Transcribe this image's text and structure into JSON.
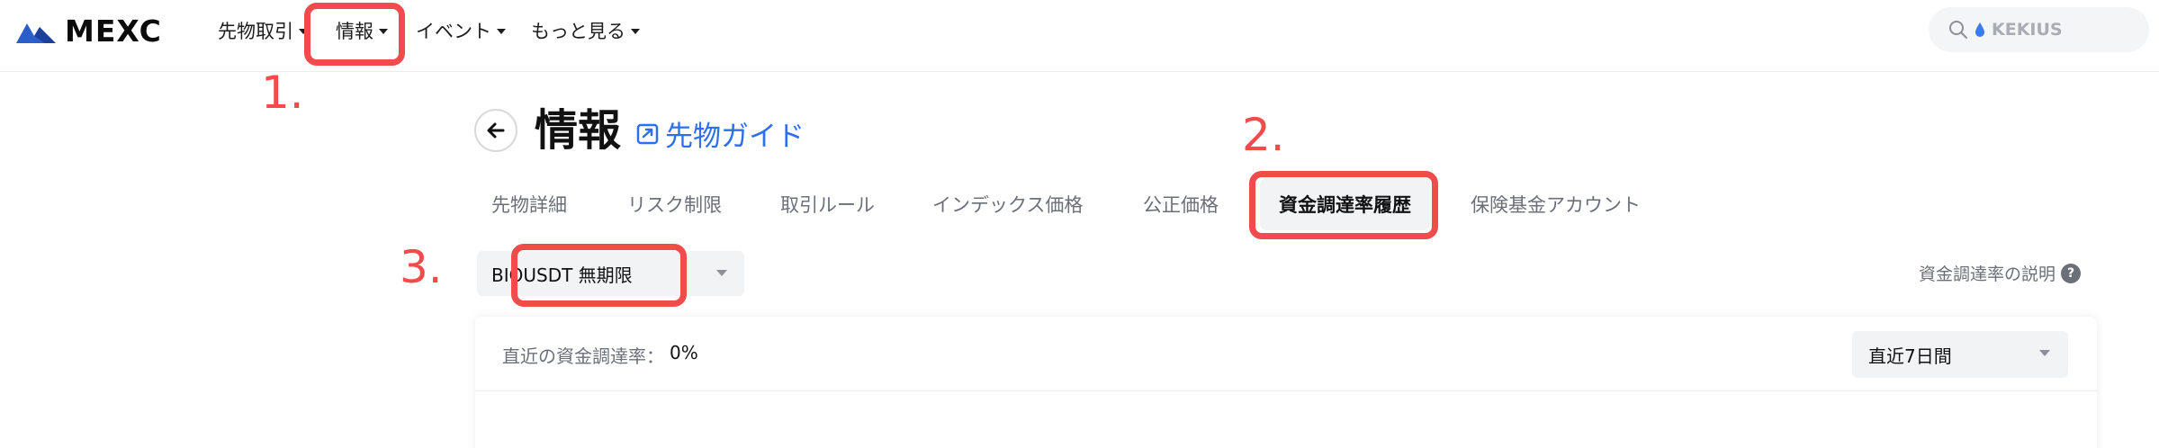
{
  "nav": {
    "logo_text": "MEXC",
    "items": [
      {
        "label": "先物取引"
      },
      {
        "label": "情報"
      },
      {
        "label": "イベント"
      },
      {
        "label": "もっと見る"
      }
    ],
    "search_placeholder": "KEKIUS"
  },
  "annotations": {
    "step1": "1.",
    "step2": "2.",
    "step3": "3.",
    "color": "#f14b4b"
  },
  "header": {
    "title": "情報",
    "guide_link": "先物ガイド"
  },
  "tabs": [
    {
      "label": "先物詳細",
      "active": false
    },
    {
      "label": "リスク制限",
      "active": false
    },
    {
      "label": "取引ルール",
      "active": false
    },
    {
      "label": "インデックス価格",
      "active": false
    },
    {
      "label": "公正価格",
      "active": false
    },
    {
      "label": "資金調達率履歴",
      "active": true
    },
    {
      "label": "保険基金アカウント",
      "active": false
    }
  ],
  "symbol_selector": {
    "value": "BIOUSDT 無期限"
  },
  "explain_link": "資金調達率の説明",
  "funding": {
    "label": "直近の資金調達率：",
    "value": "0%",
    "period": "直近7日間"
  },
  "colors": {
    "accent_blue": "#2c6ff0",
    "annotation_red": "#f14b4b"
  }
}
